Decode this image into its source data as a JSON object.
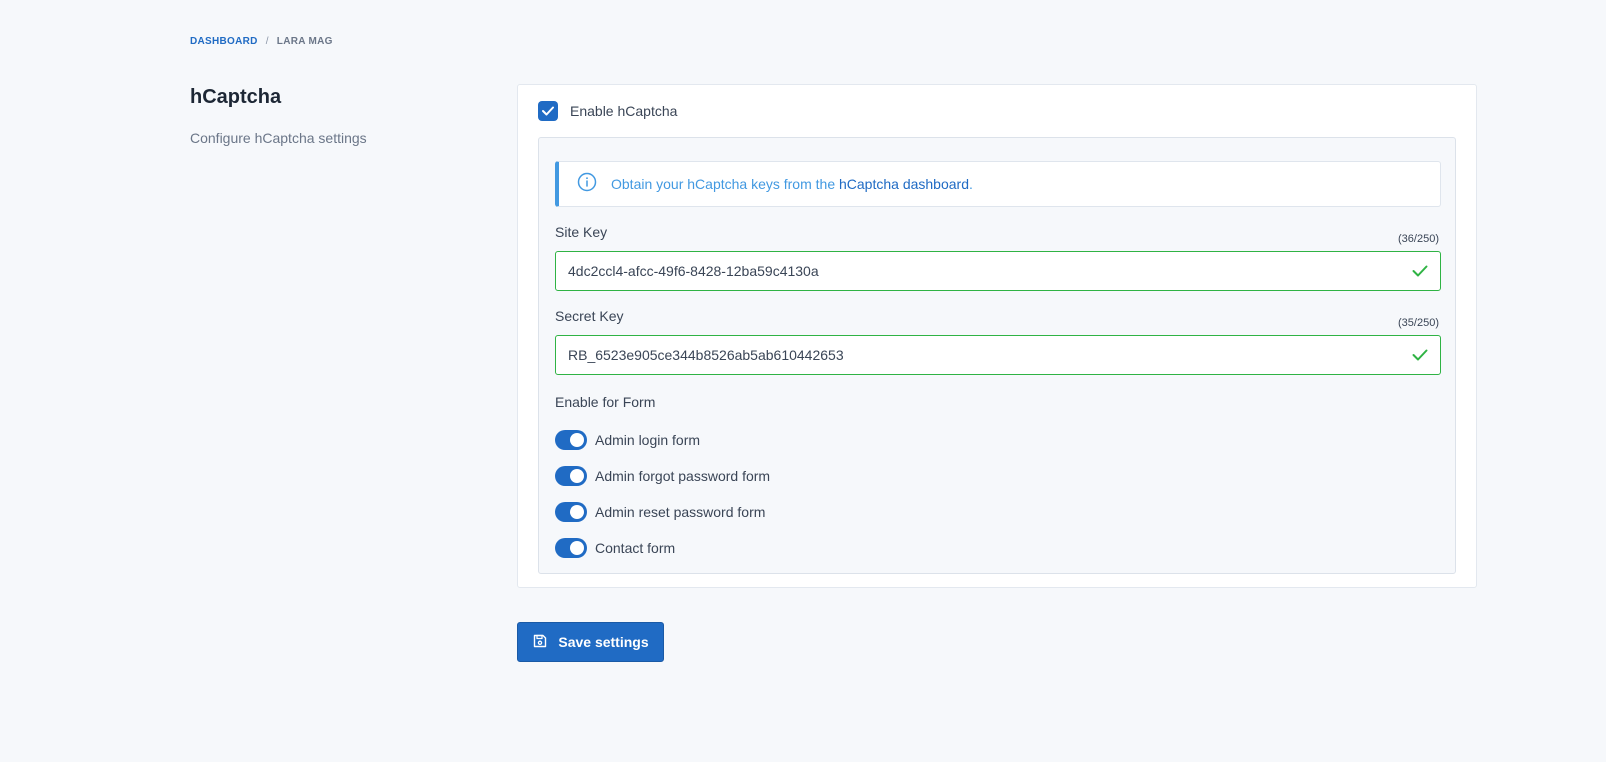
{
  "breadcrumb": {
    "items": [
      "DASHBOARD",
      "LARA MAG"
    ],
    "separator": "/"
  },
  "section": {
    "title": "hCaptcha",
    "description": "Configure hCaptcha settings"
  },
  "card": {
    "enable_checkbox": {
      "label": "Enable hCaptcha",
      "checked": true
    },
    "alert": {
      "text": "Obtain your hCaptcha keys from the ",
      "link_text": "hCaptcha dashboard",
      "suffix": ".",
      "icon": "info-icon"
    },
    "site_key": {
      "label": "Site Key",
      "counter": "(36/250)",
      "value": "4dc2ccl4-afcc-49f6-8428-12ba59c4130a",
      "status": "valid"
    },
    "secret_key": {
      "label": "Secret Key",
      "counter": "(35/250)",
      "value": "RB_6523e905ce344b8526ab5ab610442653",
      "status": "valid"
    },
    "forms": {
      "label": "Enable for Form",
      "items": [
        {
          "label": "Admin login form",
          "enabled": true
        },
        {
          "label": "Admin forgot password form",
          "enabled": true
        },
        {
          "label": "Admin reset password form",
          "enabled": true
        },
        {
          "label": "Contact form",
          "enabled": true
        }
      ]
    }
  },
  "save_button": {
    "label": "Save settings",
    "icon": "save-icon"
  },
  "colors": {
    "primary": "#206bc4",
    "info": "#4299e1",
    "success": "#2fb344",
    "background": "#f6f8fb"
  }
}
